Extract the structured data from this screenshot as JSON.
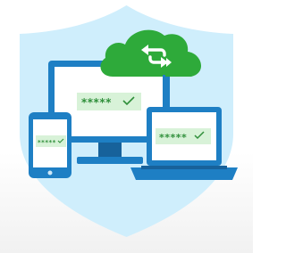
{
  "illustration": {
    "password_mask_large": "*****",
    "password_mask_small": "*****",
    "icons": {
      "shield": "shield-icon",
      "cloud_sync": "cloud-sync-icon",
      "check": "check-icon"
    },
    "colors": {
      "shield": "#cdeefb",
      "device": "#1e7fc4",
      "device_dark": "#17629b",
      "cloud": "#2faa3a",
      "field_bg": "#d8f2d8",
      "field_text": "#2f8f3a"
    }
  }
}
